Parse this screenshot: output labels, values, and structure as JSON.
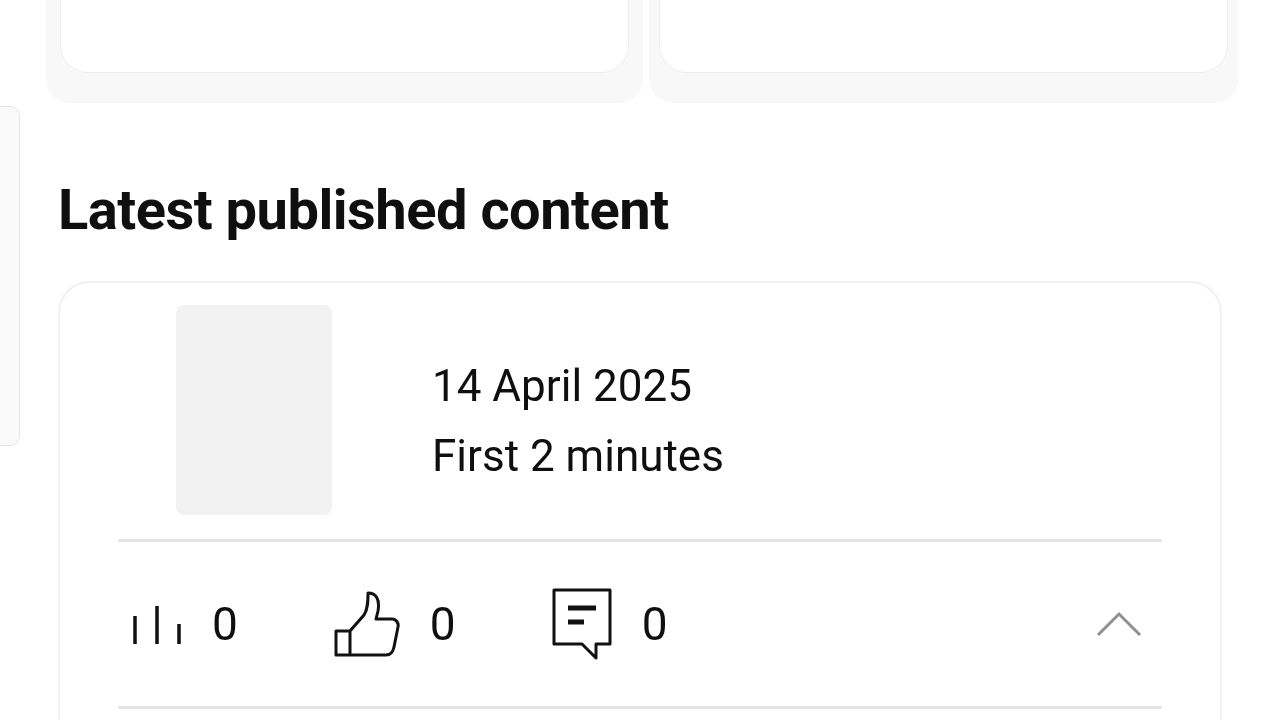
{
  "section_title": "Latest published content",
  "content": {
    "date": "14 April 2025",
    "period": "First 2 minutes",
    "expanded": true,
    "stats": [
      {
        "kind": "views",
        "count": "0"
      },
      {
        "kind": "likes",
        "count": "0"
      },
      {
        "kind": "comments",
        "count": "0"
      }
    ]
  }
}
